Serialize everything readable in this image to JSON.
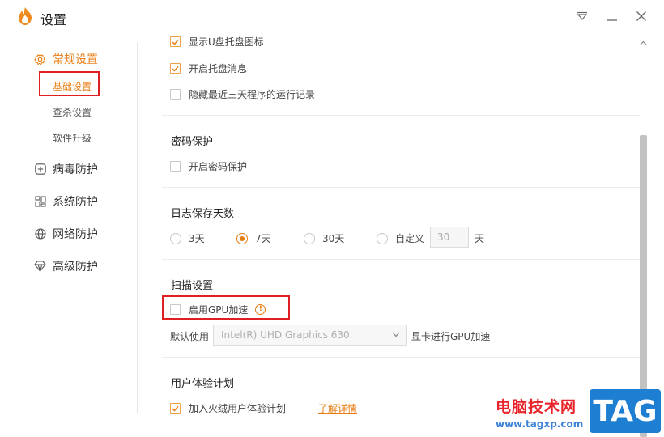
{
  "window": {
    "title": "设置"
  },
  "colors": {
    "accent": "#e87e13",
    "highlight_box": "#e02020",
    "watermark_red": "#e8232a",
    "watermark_blue": "#1e7fd2"
  },
  "sidebar": {
    "groups": [
      {
        "label": "常规设置",
        "icon": "gear-icon",
        "active": true,
        "items": [
          {
            "label": "基础设置",
            "active": true
          },
          {
            "label": "查杀设置",
            "active": false
          },
          {
            "label": "软件升级",
            "active": false
          }
        ]
      },
      {
        "label": "病毒防护",
        "icon": "plus-square-icon",
        "active": false
      },
      {
        "label": "系统防护",
        "icon": "grid-icon",
        "active": false
      },
      {
        "label": "网络防护",
        "icon": "globe-icon",
        "active": false
      },
      {
        "label": "高级防护",
        "icon": "diamond-icon",
        "active": false
      }
    ]
  },
  "content": {
    "tray": {
      "partial_label": "显示U盘托盘图标",
      "partial_checked": true,
      "options": [
        {
          "label": "开启托盘消息",
          "checked": true
        },
        {
          "label": "隐藏最近三天程序的运行记录",
          "checked": false
        }
      ]
    },
    "password": {
      "title": "密码保护",
      "option": {
        "label": "开启密码保护",
        "checked": false
      }
    },
    "log": {
      "title": "日志保存天数",
      "options": [
        {
          "label": "3天",
          "checked": false
        },
        {
          "label": "7天",
          "checked": true
        },
        {
          "label": "30天",
          "checked": false
        },
        {
          "label": "自定义",
          "checked": false
        }
      ],
      "custom_value": "30",
      "custom_unit": "天"
    },
    "scan": {
      "title": "扫描设置",
      "gpu_option": {
        "label": "启用GPU加速",
        "checked": false
      },
      "warn_glyph": "!",
      "default_prefix": "默认使用",
      "gpu_selected": "Intel(R) UHD Graphics 630",
      "default_suffix": "显卡进行GPU加速"
    },
    "ux": {
      "title": "用户体验计划",
      "option": {
        "label": "加入火绒用户体验计划",
        "checked": true
      },
      "link": "了解详情"
    }
  },
  "watermark": {
    "site_name": "电脑技术网",
    "url": "www.tagxp.com",
    "tag": "TAG"
  }
}
